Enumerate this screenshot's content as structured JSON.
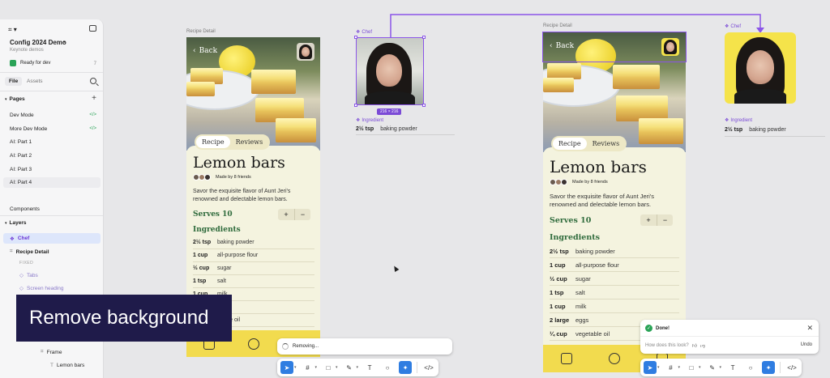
{
  "left_panel": {
    "file_title": "Config 2024 Demo",
    "file_subtitle": "Keynote demos",
    "ready_label": "Ready for dev",
    "ready_count": "7",
    "tabs": [
      "File",
      "Assets"
    ],
    "pages_header": "Pages",
    "pages": [
      "Dev Mode",
      "More Dev Mode",
      "AI: Part 1",
      "AI: Part 2",
      "AI: Part 3",
      "AI: Part 4"
    ],
    "components_label": "Components",
    "layers_header": "Layers",
    "layers": {
      "chef": "Chef",
      "recipe_detail": "Recipe Detail",
      "fixed": "FIXED",
      "tabs": "Tabs",
      "screen_heading": "Screen heading",
      "frame": "Frame",
      "lemon_bars": "Lemon bars"
    }
  },
  "caption": "Remove background",
  "canvas": {
    "frame_label_1": "Recipe Detail",
    "frame_label_2": "Recipe Detail",
    "chef_label": "Chef",
    "ingredient_label": "Ingredient",
    "size_tag": "216 × 216",
    "standalone_ingredient": {
      "qty": "2½ tsp",
      "name": "baking powder"
    }
  },
  "recipe": {
    "back": "Back",
    "tabs": [
      "Recipe",
      "Reviews"
    ],
    "title": "Lemon bars",
    "made_by": "Made by 8 friends",
    "description": "Savor the exquisite flavor of Aunt Jeri's renowned and delectable lemon bars.",
    "serves": "Serves 10",
    "stepper": [
      "+",
      "−"
    ],
    "ingredients_header": "Ingredients",
    "ingredients": [
      {
        "qty": "2½ tsp",
        "name": "baking powder"
      },
      {
        "qty": "1 cup",
        "name": "all-purpose flour"
      },
      {
        "qty": "½ cup",
        "name": "sugar"
      },
      {
        "qty": "1 tsp",
        "name": "salt"
      },
      {
        "qty": "1 cup",
        "name": "milk"
      },
      {
        "qty": "2 large",
        "name": "eggs"
      },
      {
        "qty": "¼ cup",
        "name": "vegetable oil"
      }
    ],
    "left_visible": {
      "qty4": "1 cup",
      "name4": "milk",
      "oil_partial": "etable oil"
    }
  },
  "toasts": {
    "removing": "Removing...",
    "done": "Done!",
    "feedback_question": "How does this look?",
    "undo": "Undo"
  },
  "colors": {
    "accent": "#7b4bd6",
    "bottom_bar": "#f2db4e",
    "chef_bg": "#f5e34a",
    "green_text": "#2f6b3c",
    "caption_bg": "#1f1b4a"
  }
}
